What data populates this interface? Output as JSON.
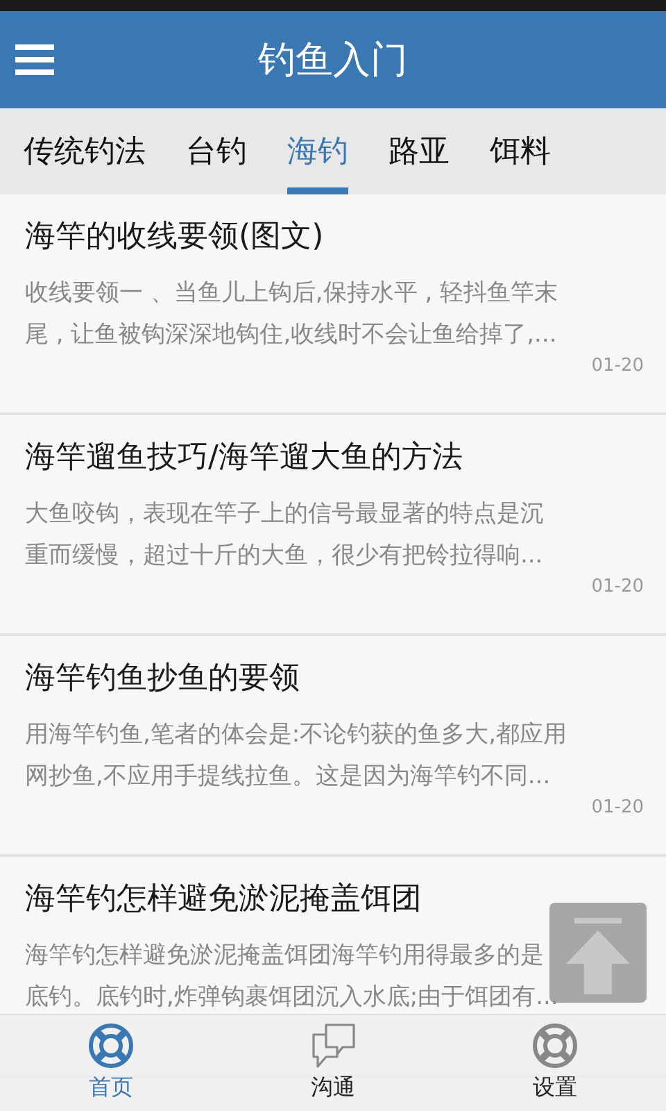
{
  "app_bar": {
    "title": "钓鱼入门"
  },
  "tabs": [
    {
      "label": "传统钓法",
      "selected": false
    },
    {
      "label": "台钓",
      "selected": false
    },
    {
      "label": "海钓",
      "selected": true
    },
    {
      "label": "路亚",
      "selected": false
    },
    {
      "label": "饵料",
      "selected": false
    }
  ],
  "articles": [
    {
      "title": "海竿的收线要领(图文)",
      "summary": [
        "收线要领一 、当鱼儿上钩后,保持水平 , 轻抖鱼竿末",
        "尾 , 让鱼被钩深深地钩住,收线时不会让鱼给掉了,..."
      ],
      "date": "01-20"
    },
    {
      "title": "海竿遛鱼技巧/海竿遛大鱼的方法",
      "summary": [
        "大鱼咬钩，表现在竿子上的信号最显著的特点是沉",
        "重而缓慢，超过十斤的大鱼，很少有把铃拉得响..."
      ],
      "date": "01-20"
    },
    {
      "title": "海竿钓鱼抄鱼的要领",
      "summary": [
        "用海竿钓鱼,笔者的体会是:不论钓获的鱼多大,都应用",
        "网抄鱼,不应用手提线拉鱼。这是因为海竿钓不同..."
      ],
      "date": "01-20"
    },
    {
      "title": "海竿钓怎样避免淤泥掩盖饵团",
      "summary": [
        "海竿钓怎样避免淤泥掩盖饵团海竿钓用得最多的是",
        "底钓。底钓时,炸弹钩裹饵团沉入水底;由于饵团有..."
      ]
    }
  ],
  "bottom_nav": [
    {
      "label": "首页",
      "kind": "buoy",
      "selected": true
    },
    {
      "label": "沟通",
      "kind": "chat",
      "selected": false
    },
    {
      "label": "设置",
      "kind": "buoy",
      "selected": false
    }
  ]
}
